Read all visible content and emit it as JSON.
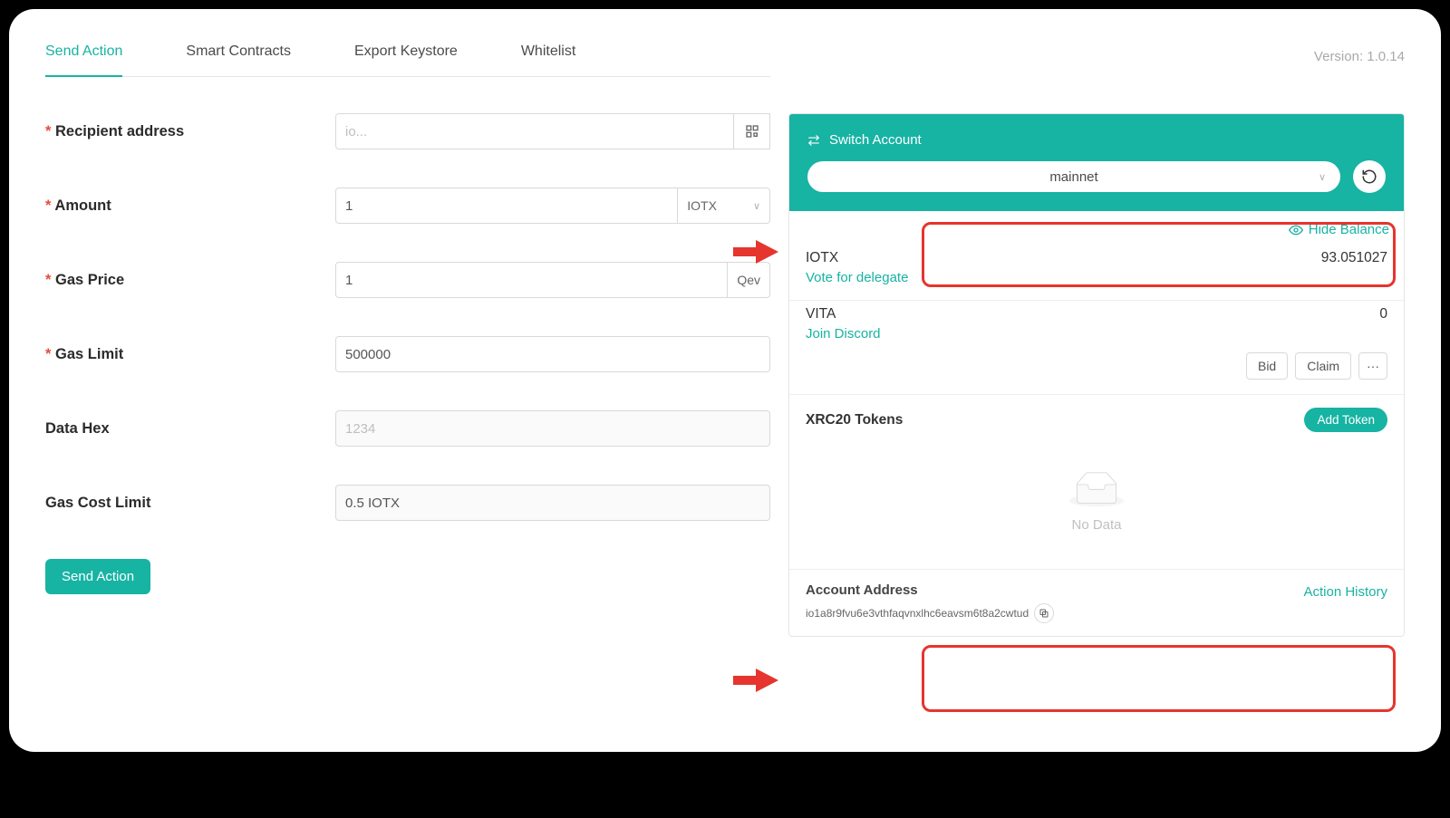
{
  "version": "Version: 1.0.14",
  "tabs": [
    "Send Action",
    "Smart Contracts",
    "Export Keystore",
    "Whitelist"
  ],
  "form": {
    "recipient_label": "Recipient address",
    "recipient_placeholder": "io...",
    "amount_label": "Amount",
    "amount_value": "1",
    "amount_token": "IOTX",
    "gas_price_label": "Gas Price",
    "gas_price_value": "1",
    "gas_price_unit": "Qev",
    "gas_limit_label": "Gas Limit",
    "gas_limit_value": "500000",
    "data_hex_label": "Data Hex",
    "data_hex_placeholder": "1234",
    "gas_cost_limit_label": "Gas Cost Limit",
    "gas_cost_limit_value": "0.5 IOTX",
    "submit_label": "Send Action"
  },
  "side": {
    "switch_label": "Switch Account",
    "network": "mainnet",
    "hide_balance": "Hide Balance",
    "iotx": {
      "name": "IOTX",
      "value": "93.051027",
      "link": "Vote for delegate"
    },
    "vita": {
      "name": "VITA",
      "value": "0",
      "link": "Join Discord"
    },
    "bid": "Bid",
    "claim": "Claim",
    "more": "···",
    "xrc_title": "XRC20 Tokens",
    "add_token": "Add Token",
    "no_data": "No Data",
    "account_address_title": "Account Address",
    "address": "io1a8r9fvu6e3vthfaqvnxlhc6eavsm6t8a2cwtud",
    "action_history": "Action History"
  }
}
